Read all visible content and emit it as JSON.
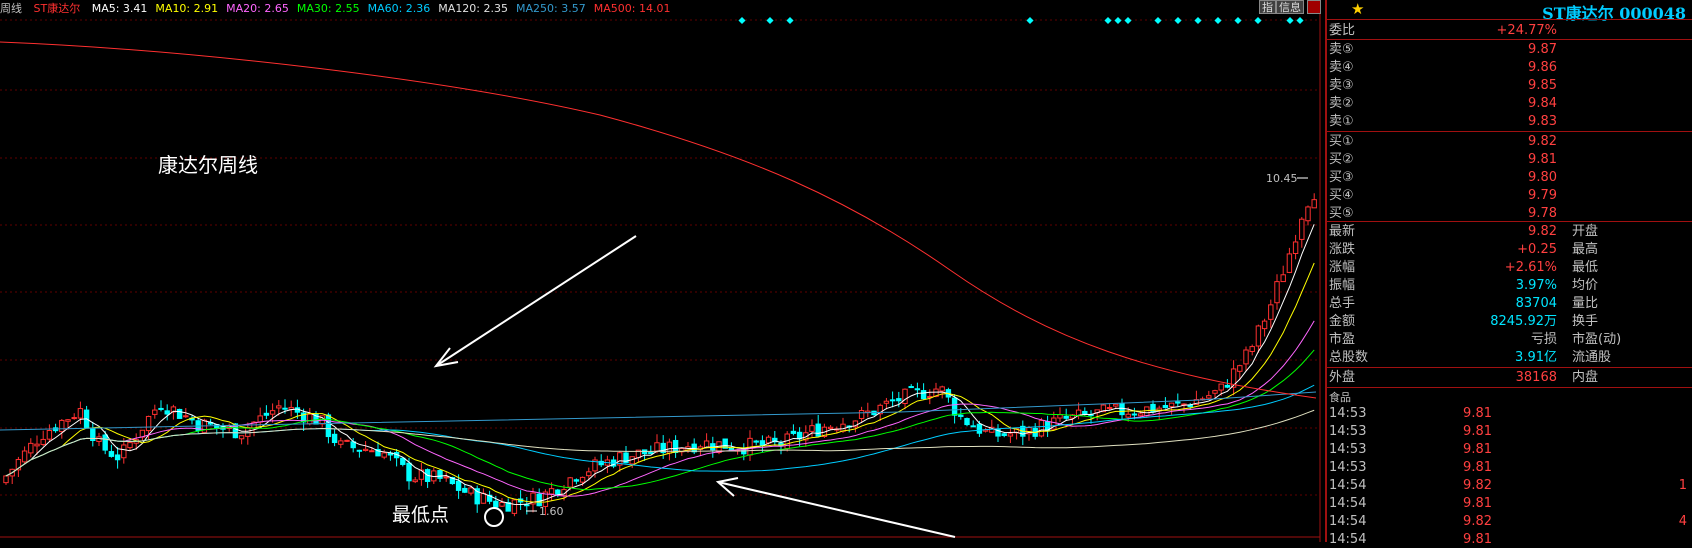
{
  "ma_bar": {
    "period": "周线",
    "stock": "ST康达尔",
    "items": [
      {
        "label": "MA5: 3.41",
        "color": "#ffffff"
      },
      {
        "label": "MA10: 2.91",
        "color": "#ffff00"
      },
      {
        "label": "MA20: 2.65",
        "color": "#ff66ff"
      },
      {
        "label": "MA30: 2.55",
        "color": "#00ff00"
      },
      {
        "label": "MA60: 2.36",
        "color": "#00ccff"
      },
      {
        "label": "MA120: 2.35",
        "color": "#e0e0e0"
      },
      {
        "label": "MA250: 3.57",
        "color": "#3399cc"
      },
      {
        "label": "MA500: 14.01",
        "color": "#ff3030"
      }
    ]
  },
  "toolbar": {
    "btn1": "指",
    "btn2": "信息"
  },
  "annotations": {
    "title": "康达尔周线",
    "low_label": "最低点",
    "low_price": "1.60",
    "high_price": "10.45"
  },
  "panel": {
    "stock_title": "ST康达尔 000048",
    "weibi_label": "委比",
    "weibi_value": "+24.77%",
    "sells": [
      {
        "label": "卖⑤",
        "price": "9.87"
      },
      {
        "label": "卖④",
        "price": "9.86"
      },
      {
        "label": "卖③",
        "price": "9.85"
      },
      {
        "label": "卖②",
        "price": "9.84"
      },
      {
        "label": "卖①",
        "price": "9.83"
      }
    ],
    "buys": [
      {
        "label": "买①",
        "price": "9.82"
      },
      {
        "label": "买②",
        "price": "9.81"
      },
      {
        "label": "买③",
        "price": "9.80"
      },
      {
        "label": "买④",
        "price": "9.79"
      },
      {
        "label": "买⑤",
        "price": "9.78"
      }
    ],
    "stats": [
      {
        "l1": "最新",
        "v1": "9.82",
        "c1": "red",
        "l2": "开盘"
      },
      {
        "l1": "涨跌",
        "v1": "+0.25",
        "c1": "red",
        "l2": "最高"
      },
      {
        "l1": "涨幅",
        "v1": "+2.61%",
        "c1": "red",
        "l2": "最低"
      },
      {
        "l1": "振幅",
        "v1": "3.97%",
        "c1": "cyan",
        "l2": "均价"
      },
      {
        "l1": "总手",
        "v1": "83704",
        "c1": "cyan",
        "l2": "量比"
      },
      {
        "l1": "金额",
        "v1": "8245.92万",
        "c1": "cyan",
        "l2": "换手"
      },
      {
        "l1": "市盈",
        "v1": "亏损",
        "c1": "plain",
        "l2": "市盈(动)"
      },
      {
        "l1": "总股数",
        "v1": "3.91亿",
        "c1": "cyan",
        "l2": "流通股"
      }
    ],
    "outer": {
      "label": "外盘",
      "value": "38168",
      "l2": "内盘"
    },
    "ticks_header": "食品",
    "ticks": [
      {
        "time": "14:53",
        "price": "9.81",
        "vol": ""
      },
      {
        "time": "14:53",
        "price": "9.81",
        "vol": ""
      },
      {
        "time": "14:53",
        "price": "9.81",
        "vol": ""
      },
      {
        "time": "14:53",
        "price": "9.81",
        "vol": ""
      },
      {
        "time": "14:54",
        "price": "9.82",
        "vol": "1"
      },
      {
        "time": "14:54",
        "price": "9.81",
        "vol": ""
      },
      {
        "time": "14:54",
        "price": "9.82",
        "vol": "4"
      },
      {
        "time": "14:54",
        "price": "9.81",
        "vol": ""
      }
    ]
  }
}
